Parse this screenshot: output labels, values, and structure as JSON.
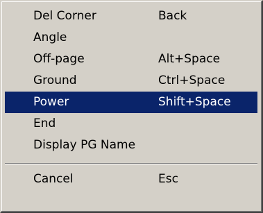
{
  "menu": {
    "items": [
      {
        "label": "Del Corner",
        "shortcut": "Back"
      },
      {
        "label": "Angle",
        "shortcut": ""
      },
      {
        "label": "Off-page",
        "shortcut": "Alt+Space"
      },
      {
        "label": "Ground",
        "shortcut": "Ctrl+Space"
      },
      {
        "label": "Power",
        "shortcut": "Shift+Space",
        "selected": true
      },
      {
        "label": "End",
        "shortcut": ""
      },
      {
        "label": "Display PG Name",
        "shortcut": ""
      },
      {
        "label": "Cancel",
        "shortcut": "Esc"
      }
    ],
    "selected_background": "#0a246a",
    "menu_background": "#d4d0c8"
  }
}
